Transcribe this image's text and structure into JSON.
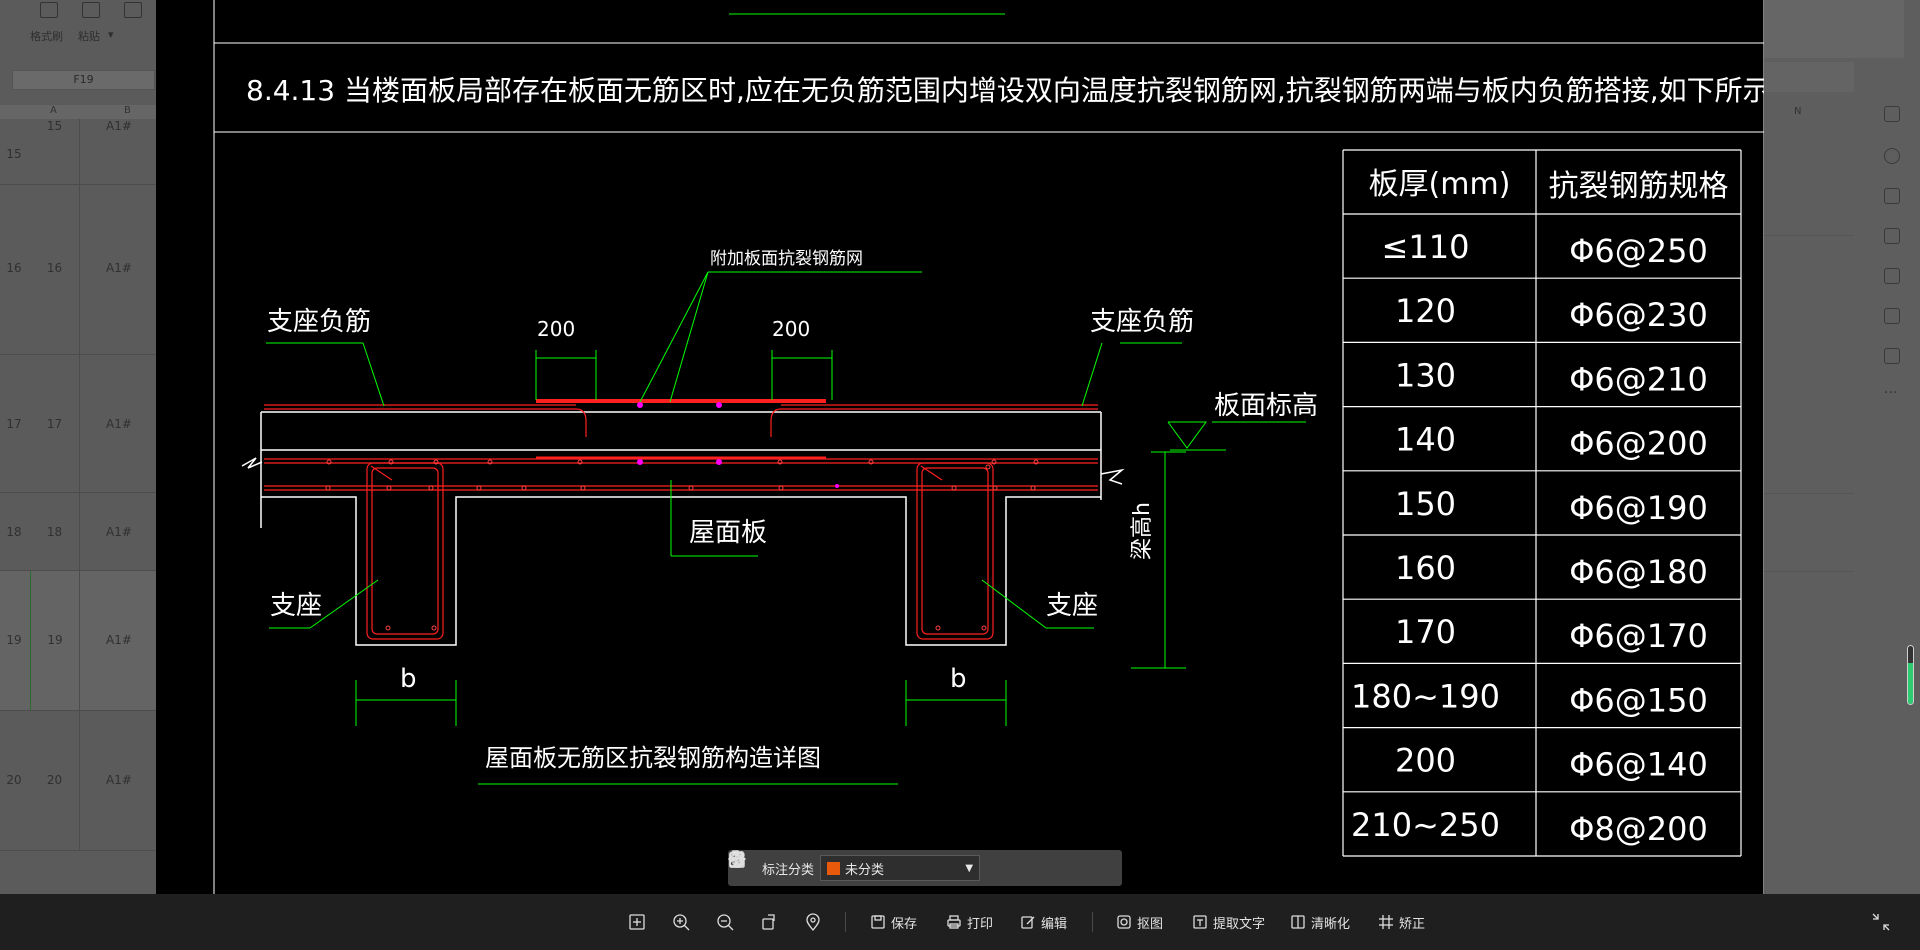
{
  "spreadsheet": {
    "ribbon": {
      "format_brush": "格式刷",
      "paste": "粘贴"
    },
    "name_box": "F19",
    "columns": [
      "A",
      "B"
    ],
    "right_column": "N",
    "rows": [
      {
        "num": "15",
        "a": "15",
        "b": "A1#"
      },
      {
        "num": "16",
        "a": "16",
        "b": "A1#"
      },
      {
        "num": "17",
        "a": "17",
        "b": "A1#"
      },
      {
        "num": "18",
        "a": "18",
        "b": "A1#"
      },
      {
        "num": "19",
        "a": "19",
        "b": "A1#"
      },
      {
        "num": "20",
        "a": "20",
        "b": "A1#"
      }
    ],
    "scroll_level": 0.7
  },
  "drawing": {
    "clause": "8.4.13 当楼面板局部存在板面无筋区时,应在无负筋范围内增设双向温度抗裂钢筋网,抗裂钢筋两端与板内负筋搭接,如下所示:",
    "labels": {
      "extra_mesh": "附加板面抗裂钢筋网",
      "dim_200_left": "200",
      "dim_200_right": "200",
      "support_neg_left": "支座负筋",
      "support_neg_right": "支座负筋",
      "slab_elev": "板面标高",
      "roof_slab": "屋面板",
      "support_left": "支座",
      "support_right": "支座",
      "b_left": "b",
      "b_right": "b",
      "beam_height": "梁高h",
      "detail_title": "屋面板无筋区抗裂钢筋构造详图"
    },
    "table": {
      "headers": [
        "板厚(mm)",
        "抗裂钢筋规格"
      ],
      "rows": [
        [
          "≤110",
          "Φ6@250"
        ],
        [
          "120",
          "Φ6@230"
        ],
        [
          "130",
          "Φ6@210"
        ],
        [
          "140",
          "Φ6@200"
        ],
        [
          "150",
          "Φ6@190"
        ],
        [
          "160",
          "Φ6@180"
        ],
        [
          "170",
          "Φ6@170"
        ],
        [
          "180~190",
          "Φ6@150"
        ],
        [
          "200",
          "Φ6@140"
        ],
        [
          "210~250",
          "Φ8@200"
        ]
      ]
    },
    "colors": {
      "line": "#ffffff",
      "leader": "#00ff00",
      "rebar": "#ff2020",
      "rebar_dot": "#ff00ff"
    }
  },
  "annotation_bar": {
    "label": "标注分类",
    "selected": "未分类",
    "swatch_color": "#e8590c"
  },
  "toolbar": {
    "save": "保存",
    "print": "打印",
    "edit": "编辑",
    "crop": "抠图",
    "extract_text": "提取文字",
    "sharpen": "清晰化",
    "rectify": "矫正"
  }
}
